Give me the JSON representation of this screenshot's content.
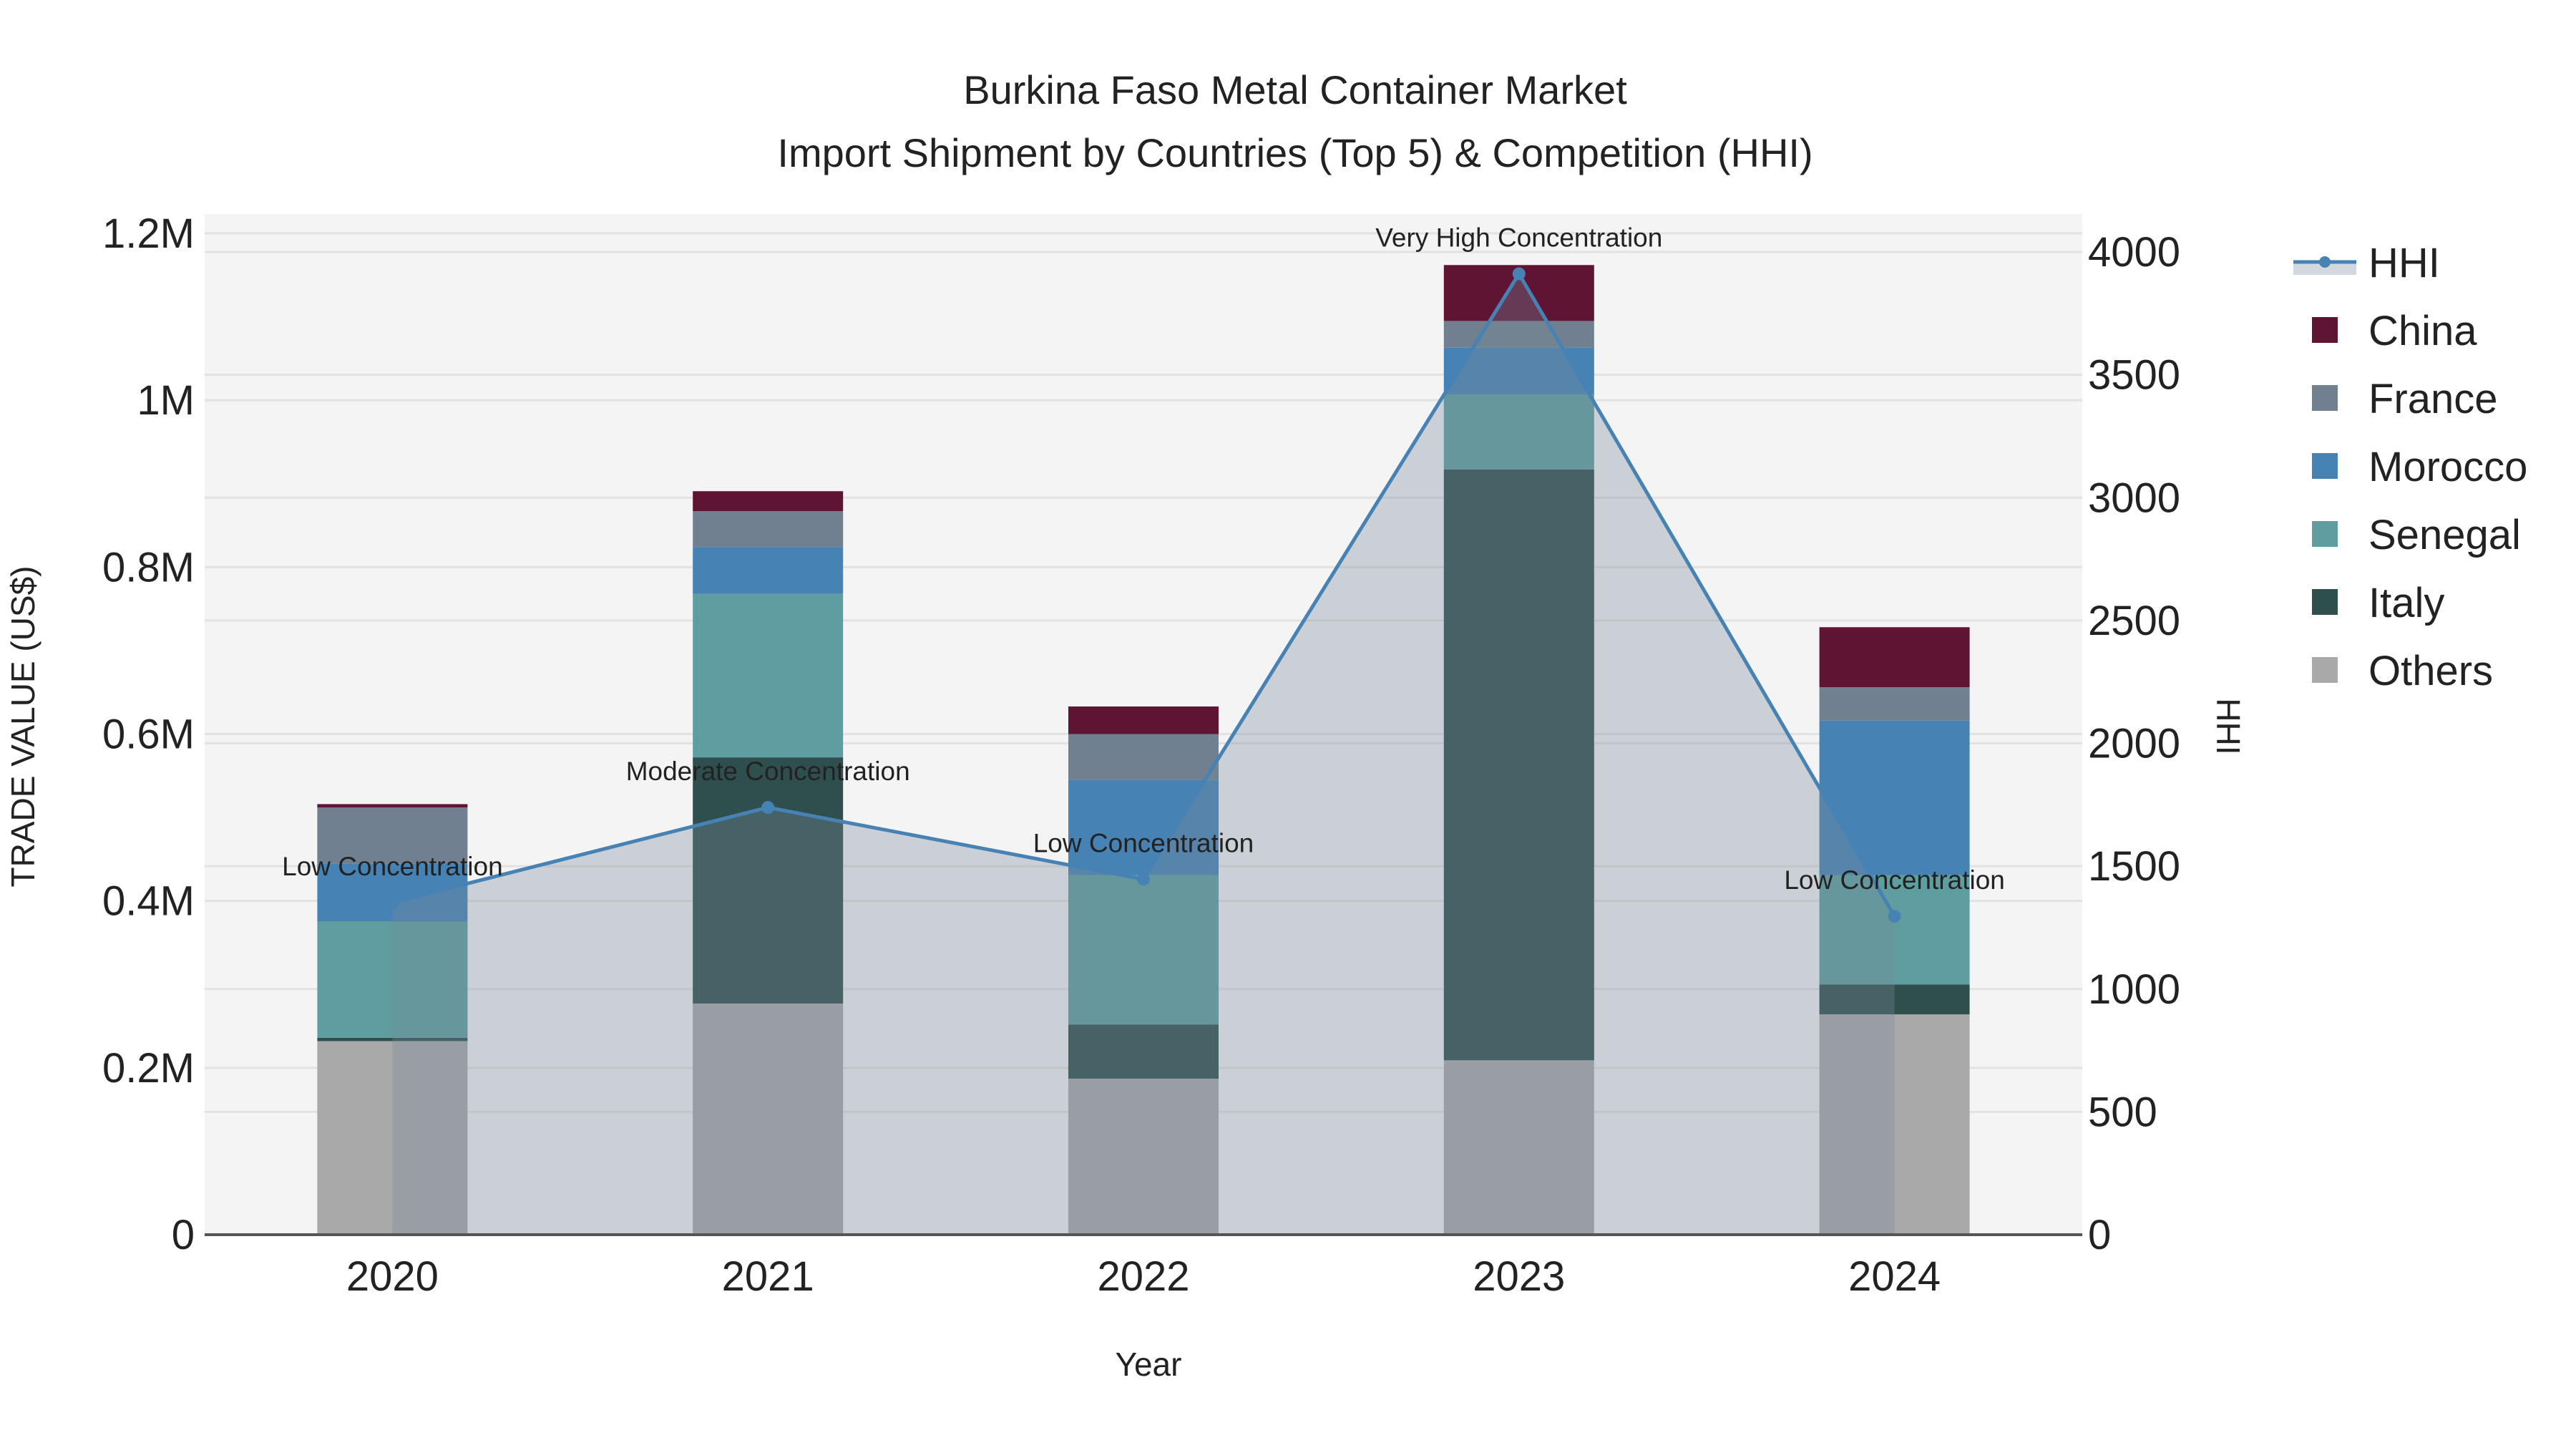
{
  "chart_data": {
    "type": "bar",
    "stacked": true,
    "title": "Burkina Faso Metal Container Market",
    "subtitle": "Import Shipment by Countries (Top 5) & Competition (HHI)",
    "xlabel": "Year",
    "ylabel": "TRADE VALUE (US$)",
    "y2label": "HHI",
    "categories": [
      "2020",
      "2021",
      "2022",
      "2023",
      "2024"
    ],
    "ylim": [
      0,
      1200000
    ],
    "y2lim": [
      0,
      4000
    ],
    "yticks": [
      {
        "v": 0,
        "label": "0"
      },
      {
        "v": 200000,
        "label": "0.2M"
      },
      {
        "v": 400000,
        "label": "0.4M"
      },
      {
        "v": 600000,
        "label": "0.6M"
      },
      {
        "v": 800000,
        "label": "0.8M"
      },
      {
        "v": 1000000,
        "label": "1M"
      },
      {
        "v": 1200000,
        "label": "1.2M"
      }
    ],
    "y2ticks": [
      {
        "v": 0,
        "label": "0"
      },
      {
        "v": 500,
        "label": "500"
      },
      {
        "v": 1000,
        "label": "1000"
      },
      {
        "v": 1500,
        "label": "1500"
      },
      {
        "v": 2000,
        "label": "2000"
      },
      {
        "v": 2500,
        "label": "2500"
      },
      {
        "v": 3000,
        "label": "3000"
      },
      {
        "v": 3500,
        "label": "3500"
      },
      {
        "v": 4000,
        "label": "4000"
      }
    ],
    "series": [
      {
        "name": "Others",
        "color": "#a9a9a9",
        "values": [
          232000,
          277000,
          187000,
          209000,
          264000
        ]
      },
      {
        "name": "Italy",
        "color": "#2f4f4f",
        "values": [
          4000,
          295000,
          65000,
          708000,
          36000
        ]
      },
      {
        "name": "Senegal",
        "color": "#5f9ea0",
        "values": [
          139000,
          196000,
          179000,
          90000,
          131000
        ]
      },
      {
        "name": "Morocco",
        "color": "#4682b4",
        "values": [
          70000,
          56000,
          114000,
          56000,
          185000
        ]
      },
      {
        "name": "France",
        "color": "#708090",
        "values": [
          67000,
          43000,
          55000,
          32000,
          40000
        ]
      },
      {
        "name": "China",
        "color": "#5f1434",
        "values": [
          4000,
          24000,
          33000,
          67000,
          72000
        ]
      }
    ],
    "hhi": {
      "name": "HHI",
      "color": "#4682b4",
      "values": [
        1352,
        1739,
        1447,
        3911,
        1296
      ],
      "annotations": [
        "Low Concentration",
        "Moderate Concentration",
        "Low Concentration",
        "Very High Concentration",
        "Low Concentration"
      ]
    },
    "legend": [
      "HHI",
      "China",
      "France",
      "Morocco",
      "Senegal",
      "Italy",
      "Others"
    ],
    "legend_position": "right",
    "grid": true
  }
}
